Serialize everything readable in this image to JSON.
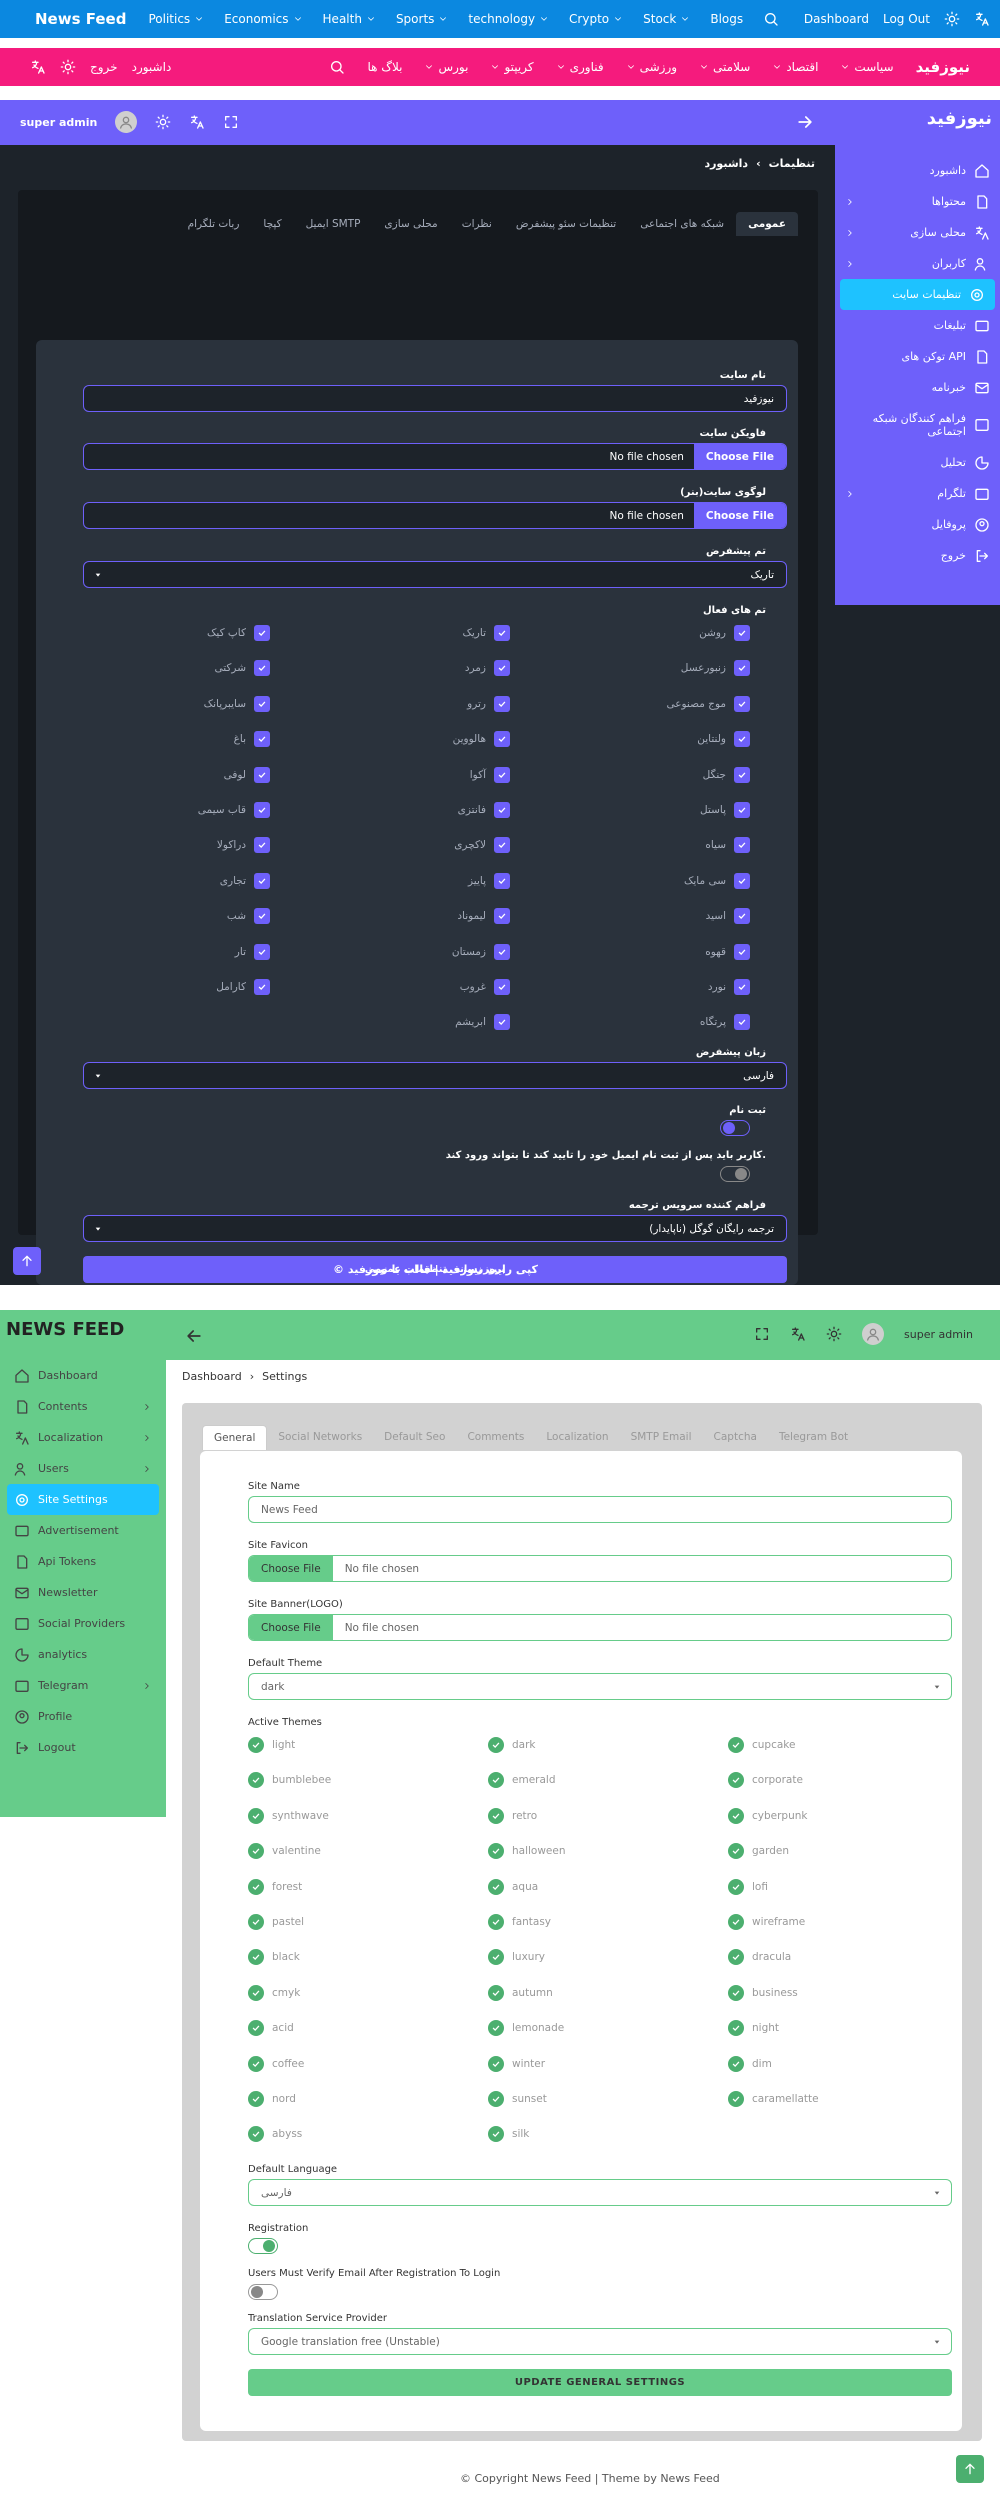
{
  "nav1": {
    "brand": "News Feed",
    "items": [
      "Politics",
      "Economics",
      "Health",
      "Sports",
      "technology",
      "Crypto",
      "Stock"
    ],
    "blogs": "Blogs",
    "dashboard": "Dashboard",
    "logout": "Log Out"
  },
  "nav2": {
    "brand": "نیوزفید",
    "items": [
      "سیاست",
      "اقتصاد",
      "سلامتی",
      "ورزشی",
      "فناوری",
      "کریپتو",
      "بورس"
    ],
    "blogs": "بلاگ ها",
    "logout": "خروج",
    "dashboard": "داشبورد"
  },
  "dark": {
    "title": "نیوزفید",
    "user": "super admin",
    "sidebar": [
      "داشبورد",
      "محتواها",
      "محلی سازی",
      "کاربران",
      "تنظیمات سایت",
      "تبلیغات",
      "توکن های API",
      "خبرنامه",
      "فراهم کنندگان شبکه اجتماعی",
      "تحلیل",
      "تلگرام",
      "پروفایل",
      "خروج"
    ],
    "crumb": [
      "داشبورد",
      "تنظیمات"
    ],
    "tabs": [
      "عمومی",
      "شبکه های اجتماعی",
      "تنظیمات سئو پیشفرض",
      "نظرات",
      "محلی سازی",
      "ایمیل SMTP",
      "کپچا",
      "ربات تلگرام"
    ],
    "site_name_label": "نام سایت",
    "site_name": "نیوزفید",
    "favicon_label": "فاویکن سایت",
    "banner_label": "لوگوی سایت(بنر)",
    "choose_file": "Choose File",
    "no_file": "No file chosen",
    "theme_label": "تم پیشفرض",
    "theme_value": "تاریک",
    "active_label": "تم های فعال",
    "themes": [
      "روشن",
      "تاریک",
      "کاپ کیک",
      "زنبورعسل",
      "زمرد",
      "شرکتی",
      "موج مصنوعی",
      "رترو",
      "سایبرپانک",
      "ولنتاین",
      "هالووین",
      "باغ",
      "جنگل",
      "آکوا",
      "لوفی",
      "پاستل",
      "فانتزی",
      "قاب سیمی",
      "سیاه",
      "لاکچری",
      "دراکولا",
      "سی مایک",
      "پاییز",
      "تجاری",
      "اسید",
      "لیموناد",
      "شب",
      "قهوه",
      "زمستان",
      "تار",
      "نورد",
      "غروب",
      "کارامل",
      "پرتگاه",
      "ابریشم"
    ],
    "lang_label": "زبان پیشفرض",
    "lang_value": "فارسی",
    "reg_label": "ثبت نام",
    "verify_label": "کاربر باید پس از ثبت نام ایمیل خود را تایید کند تا بتواند ورود کند.",
    "trans_label": "فراهم کننده سرویس ترجمه",
    "trans_value": "ترجمه رایگان گوگل (ناپایدار)",
    "update": "بروزرسانی تنظیمات عمومی",
    "footer": "© کپی رایت نیوزفید | قالب با نیوزفید"
  },
  "light": {
    "title": "NEWS FEED",
    "user": "super admin",
    "sidebar": [
      "Dashboard",
      "Contents",
      "Localization",
      "Users",
      "Site Settings",
      "Advertisement",
      "Api Tokens",
      "Newsletter",
      "Social Providers",
      "analytics",
      "Telegram",
      "Profile",
      "Logout"
    ],
    "crumb": [
      "Dashboard",
      "Settings"
    ],
    "tabs": [
      "General",
      "Social Networks",
      "Default Seo",
      "Comments",
      "Localization",
      "SMTP Email",
      "Captcha",
      "Telegram Bot"
    ],
    "site_name_label": "Site Name",
    "site_name": "News Feed",
    "favicon_label": "Site Favicon",
    "banner_label": "Site Banner(LOGO)",
    "choose_file": "Choose File",
    "no_file": "No file chosen",
    "theme_label": "Default Theme",
    "theme_value": "dark",
    "active_label": "Active Themes",
    "themes": [
      "light",
      "dark",
      "cupcake",
      "bumblebee",
      "emerald",
      "corporate",
      "synthwave",
      "retro",
      "cyberpunk",
      "valentine",
      "halloween",
      "garden",
      "forest",
      "aqua",
      "lofi",
      "pastel",
      "fantasy",
      "wireframe",
      "black",
      "luxury",
      "dracula",
      "cmyk",
      "autumn",
      "business",
      "acid",
      "lemonade",
      "night",
      "coffee",
      "winter",
      "dim",
      "nord",
      "sunset",
      "caramellatte",
      "abyss",
      "silk"
    ],
    "lang_label": "Default Language",
    "lang_value": "فارسی",
    "reg_label": "Registration",
    "verify_label": "Users Must Verify Email After Registration To Login",
    "trans_label": "Translation Service Provider",
    "trans_value": "Google translation free (Unstable)",
    "update": "UPDATE GENERAL SETTINGS",
    "footer": "© Copyright News Feed | Theme by News Feed"
  },
  "colors": {
    "nav1": "#0b88e0",
    "nav2": "#f51b7d",
    "dark_accent": "#6e60fa",
    "light_accent": "#66cc8a",
    "active_item": "#1ec2ff"
  }
}
